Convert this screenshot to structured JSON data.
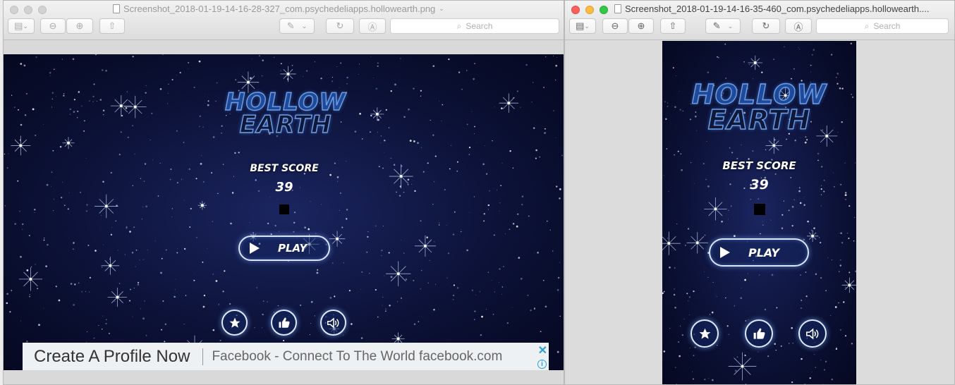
{
  "left_window": {
    "title": "Screenshot_2018-01-19-14-16-28-327_com.psychedeliapps.hollowearth.png",
    "search_placeholder": "Search",
    "game": {
      "logo_line1": "HOLLOW",
      "logo_line2": "EARTH",
      "best_score_label": "BEST SCORE",
      "best_score_value": "39",
      "play_label": "PLAY"
    },
    "ad": {
      "headline": "Create A Profile Now",
      "description": "Facebook - Connect To The World facebook.com",
      "close_symbol": "✕",
      "info_symbol": "i"
    }
  },
  "right_window": {
    "title": "Screenshot_2018-01-19-14-16-35-460_com.psychedeliapps.hollowearth....",
    "search_placeholder": "Search",
    "game": {
      "logo_line1": "HOLLOW",
      "logo_line2": "EARTH",
      "best_score_label": "BEST SCORE",
      "best_score_value": "39",
      "play_label": "PLAY"
    }
  },
  "toolbar_icons": {
    "sidebar": "▤",
    "zoom_out": "⊖",
    "zoom_in": "⊕",
    "share": "⇧",
    "markup": "✎",
    "rotate": "↻",
    "annotate": "Ⓐ",
    "search_glyph": "⌕"
  },
  "colors": {
    "game_bg": "#0c1238",
    "accent_blue": "#6fa0e6",
    "ad_link": "#2a9fd8"
  }
}
